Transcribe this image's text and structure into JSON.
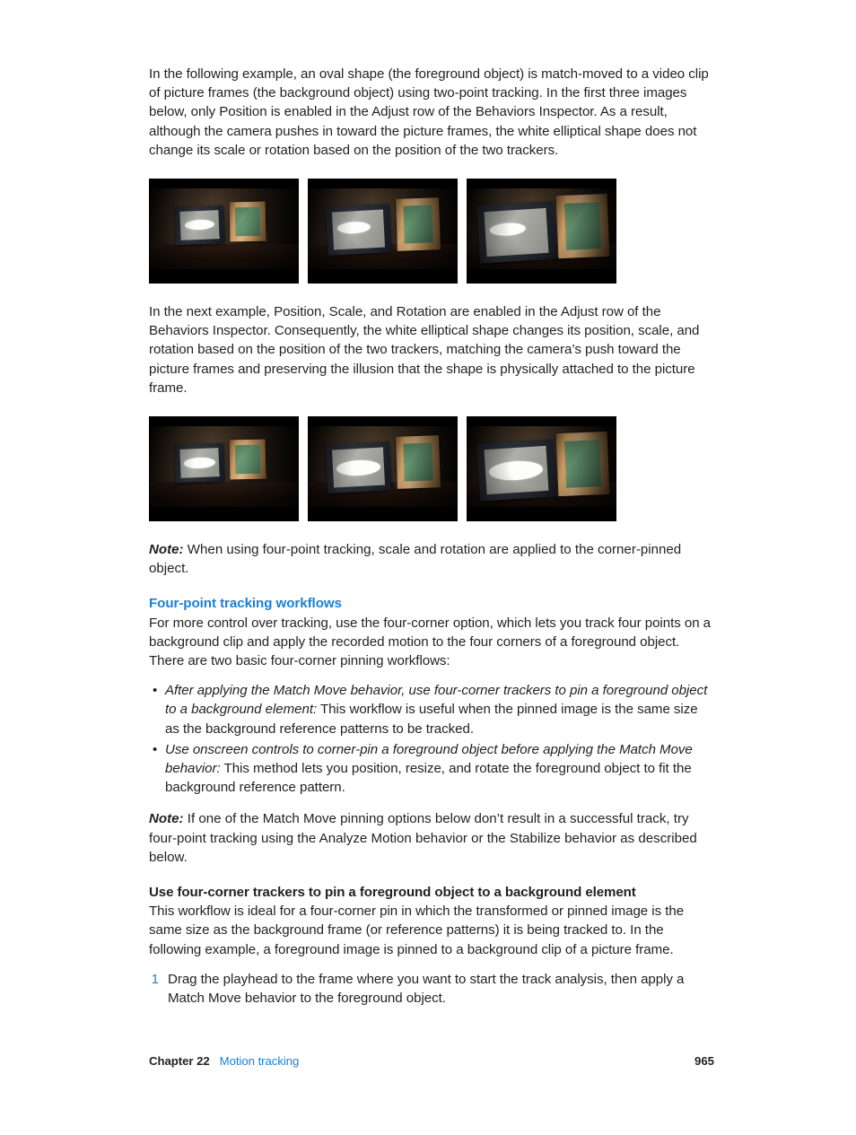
{
  "document": {
    "paragraph_1": "In the following example, an oval shape (the foreground object) is match-moved to a video clip of picture frames (the background object) using two-point tracking. In the first three images below, only Position is enabled in the Adjust row of the Behaviors Inspector. As a result, although the camera pushes in toward the picture frames, the white elliptical shape does not change its scale or rotation based on the position of the two trackers.",
    "paragraph_2": "In the next example, Position, Scale, and Rotation are enabled in the Adjust row of the Behaviors Inspector. Consequently, the white elliptical shape changes its position, scale, and rotation based on the position of the two trackers, matching the camera’s push toward the picture frames and preserving the illusion that the shape is physically attached to the picture frame.",
    "note_1": {
      "label": "Note:",
      "text": "When using four-point tracking, scale and rotation are applied to the corner-pinned object."
    },
    "heading_blue": "Four-point tracking workflows",
    "paragraph_3": "For more control over tracking, use the four-corner option, which lets you track four points on a background clip and apply the recorded motion to the four corners of a foreground object. There are two basic four-corner pinning workflows:",
    "bullets": [
      {
        "lead": "After applying the Match Move behavior, use four-corner trackers to pin a foreground object to a background element:",
        "text": " This workflow is useful when the pinned image is the same size as the background reference patterns to be tracked."
      },
      {
        "lead": "Use onscreen controls to corner-pin a foreground object before applying the Match Move behavior:",
        "text": " This method lets you position, resize, and rotate the foreground object to fit the background reference pattern."
      }
    ],
    "note_2": {
      "label": "Note:",
      "text": "If one of the Match Move pinning options below don’t result in a successful track, try four-point tracking using the Analyze Motion behavior or the Stabilize behavior as described below."
    },
    "heading_bold": "Use four-corner trackers to pin a foreground object to a background element",
    "paragraph_4": "This workflow is ideal for a four-corner pin in which the transformed or pinned image is the same size as the background frame (or reference patterns) it is being tracked to. In the following example, a foreground image is pinned to a background clip of a picture frame.",
    "steps": [
      {
        "number": "1",
        "text": "Drag the playhead to the frame where you want to start the track analysis, then apply a Match Move behavior to the foreground object."
      }
    ]
  },
  "figures": {
    "row_1": {
      "caption_context": "Position only enabled — oval does not scale or rotate",
      "images": [
        {
          "alt": "picture frames with white oval, camera wide"
        },
        {
          "alt": "picture frames with white oval, camera medium"
        },
        {
          "alt": "picture frames with white oval, camera close"
        }
      ]
    },
    "row_2": {
      "caption_context": "Position, Scale, and Rotation enabled — oval scales and rotates",
      "images": [
        {
          "alt": "picture frames with scaled white oval, camera wide"
        },
        {
          "alt": "picture frames with scaled white oval, camera medium"
        },
        {
          "alt": "picture frames with scaled white oval, camera close"
        }
      ]
    }
  },
  "footer": {
    "chapter": "Chapter 22",
    "chapter_title": "Motion tracking",
    "page_number": "965"
  },
  "colors": {
    "link_blue": "#1b7fd1",
    "body_text": "#231f20",
    "page_background": "#ffffff"
  }
}
